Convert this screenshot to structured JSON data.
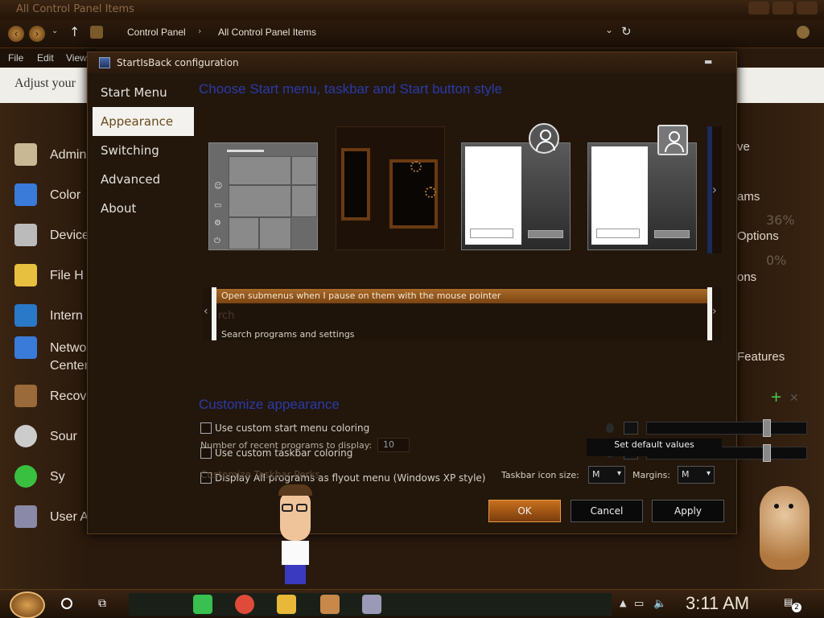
{
  "explorer": {
    "title": "All Control Panel Items",
    "breadcrumb": [
      "Control Panel",
      "All Control Panel Items"
    ],
    "menu": [
      "File",
      "Edit",
      "View"
    ],
    "adjust_text": "Adjust your",
    "left_items": [
      {
        "label": "Admin",
        "color": "#c8b894"
      },
      {
        "label": "Color",
        "color": "#3a7ad8"
      },
      {
        "label": "Device",
        "color": "#bbbbbb"
      },
      {
        "label": "File H",
        "color": "#e8c040"
      },
      {
        "label": "Intern",
        "color": "#2a78c8"
      },
      {
        "label": "Netwo",
        "color": "#3a7ad8"
      },
      {
        "label": "Center",
        "color": ""
      },
      {
        "label": "Recove",
        "color": "#9a6a3a"
      },
      {
        "label": "Sour",
        "color": "#cccccc"
      },
      {
        "label": "Sy",
        "color": "#3ac040"
      },
      {
        "label": "User A",
        "color": "#8a8aa8"
      }
    ],
    "right_items": [
      "ve",
      "ams",
      "Options",
      "ons",
      "Features"
    ],
    "right_pcts": [
      "36%",
      "0%"
    ]
  },
  "dialog": {
    "title": "StartIsBack configuration",
    "sidebar": [
      "Start Menu",
      "Appearance",
      "Switching",
      "Advanced",
      "About"
    ],
    "active_index": 1,
    "heading_style": "Choose Start menu, taskbar and Start button style",
    "preview": {
      "highlight": "Open submenus when I pause on them with the mouse pointer",
      "placeholder": "rch",
      "search_text": "Search programs and settings"
    },
    "plus": "+",
    "remove": "✕",
    "heading_customize": "Customize appearance",
    "options": [
      "Use custom start menu coloring",
      "Use custom taskbar coloring",
      "Display All programs as flyout menu (Windows XP style)"
    ],
    "recent_label": "Number of recent programs to display:",
    "recent_value": "10",
    "set_default": "Set default values",
    "perks": "Customize Taskbar Perks...",
    "icon_size_label": "Taskbar icon size:",
    "icon_size_value": "M",
    "margins_label": "Margins:",
    "margins_value": "M",
    "ok": "OK",
    "cancel": "Cancel",
    "apply": "Apply"
  },
  "taskbar": {
    "clock": "3:11 AM",
    "notifications": "2",
    "apps": [
      {
        "name": "messages-app",
        "color": "#3ac050"
      },
      {
        "name": "chrome-app",
        "color": "#e04a3a"
      },
      {
        "name": "file-explorer-app",
        "color": "#e8b838"
      },
      {
        "name": "control-panel-app",
        "color": "#c8884a"
      },
      {
        "name": "startisback-app",
        "color": "#9a9ab8"
      }
    ]
  }
}
